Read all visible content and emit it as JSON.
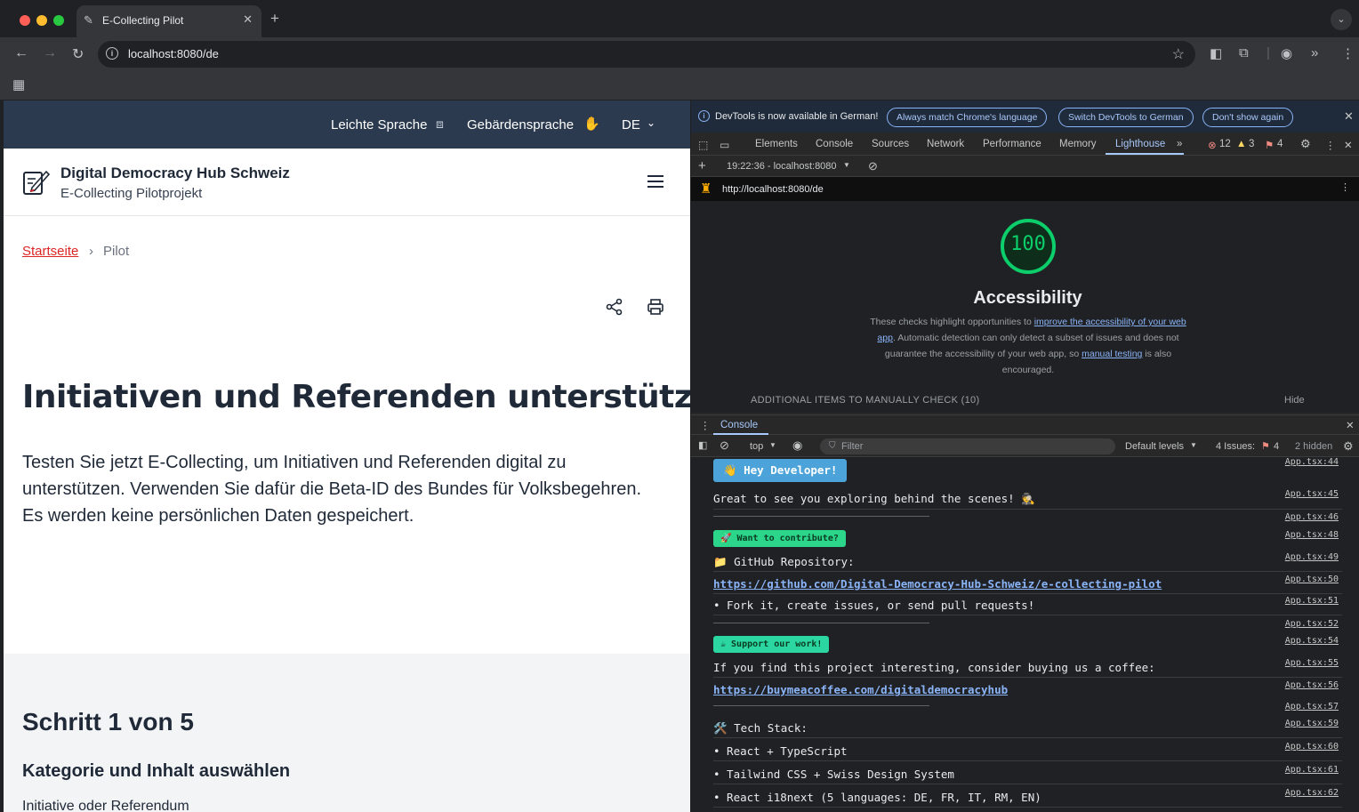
{
  "browser": {
    "tab_title": "E-Collecting Pilot",
    "url": "localhost:8080/de"
  },
  "page": {
    "topbar": {
      "easy_language": "Leichte Sprache",
      "sign_language": "Gebärdensprache",
      "lang": "DE"
    },
    "site_title": "Digital Democracy Hub Schweiz",
    "site_subtitle": "E-Collecting Pilotprojekt",
    "breadcrumb": {
      "home": "Startseite",
      "sep": "›",
      "current": "Pilot"
    },
    "heading": "Initiativen und Referenden unterstützen",
    "lead": "Testen Sie jetzt E-Collecting, um Initiativen und Referenden digital zu unterstützen. Verwenden Sie dafür die Beta-ID des Bundes für Volksbegehren. Es werden keine persönlichen Daten gespeichert.",
    "step": "Schritt 1 von 5",
    "step_heading": "Kategorie und Inhalt auswählen",
    "step_label": "Initiative oder Referendum"
  },
  "devtools": {
    "infobar": {
      "text": "DevTools is now available in German!",
      "btn_match": "Always match Chrome's language",
      "btn_switch": "Switch DevTools to German",
      "btn_dont": "Don't show again"
    },
    "tabs": [
      "Elements",
      "Console",
      "Sources",
      "Network",
      "Performance",
      "Memory",
      "Lighthouse"
    ],
    "counts": {
      "errors": "12",
      "warnings": "3",
      "issues": "4"
    },
    "report_time": "19:22:36 - localhost:8080",
    "report_url": "http://localhost:8080/de",
    "lighthouse": {
      "score": "100",
      "title": "Accessibility",
      "desc_1": "These checks highlight opportunities to ",
      "desc_link_1": "improve the accessibility of your web app",
      "desc_2": ". Automatic detection can only detect a subset of issues and does not guarantee the accessibility of your web app, so ",
      "desc_link_2": "manual testing",
      "desc_3": " is also encouraged.",
      "additional": "ADDITIONAL ITEMS TO MANUALLY CHECK (10)",
      "hide": "Hide"
    },
    "console": {
      "title": "Console",
      "context": "top",
      "filter": "Filter",
      "levels": "Default levels",
      "issues_label": "4 Issues:",
      "issues_count": "4",
      "hidden": "2 hidden",
      "lines": [
        {
          "text": "👋 Hey Developer!",
          "src": "App.tsx:44"
        },
        {
          "text": "Great to see you exploring behind the scenes! 🕵️",
          "src": "App.tsx:45"
        },
        {
          "text": "",
          "src": "App.tsx:46"
        },
        {
          "text": "🚀 Want to contribute?",
          "src": "App.tsx:48"
        },
        {
          "text": "📁 GitHub Repository:",
          "src": "App.tsx:49"
        },
        {
          "text": "https://github.com/Digital-Democracy-Hub-Schweiz/e-collecting-pilot",
          "src": "App.tsx:50"
        },
        {
          "text": "• Fork it, create issues, or send pull requests!",
          "src": "App.tsx:51"
        },
        {
          "text": "",
          "src": "App.tsx:52"
        },
        {
          "text": "☕ Support our work!",
          "src": "App.tsx:54"
        },
        {
          "text": "If you find this project interesting, consider buying us a coffee:",
          "src": "App.tsx:55"
        },
        {
          "text": "https://buymeacoffee.com/digitaldemocracyhub",
          "src": "App.tsx:56"
        },
        {
          "text": "",
          "src": "App.tsx:57"
        },
        {
          "text": "🛠️ Tech Stack:",
          "src": "App.tsx:59"
        },
        {
          "text": "• React + TypeScript",
          "src": "App.tsx:60"
        },
        {
          "text": "• Tailwind CSS + Swiss Design System",
          "src": "App.tsx:61"
        },
        {
          "text": "• React i18next (5 languages: DE, FR, IT, RM, EN)",
          "src": "App.tsx:62"
        }
      ]
    }
  }
}
